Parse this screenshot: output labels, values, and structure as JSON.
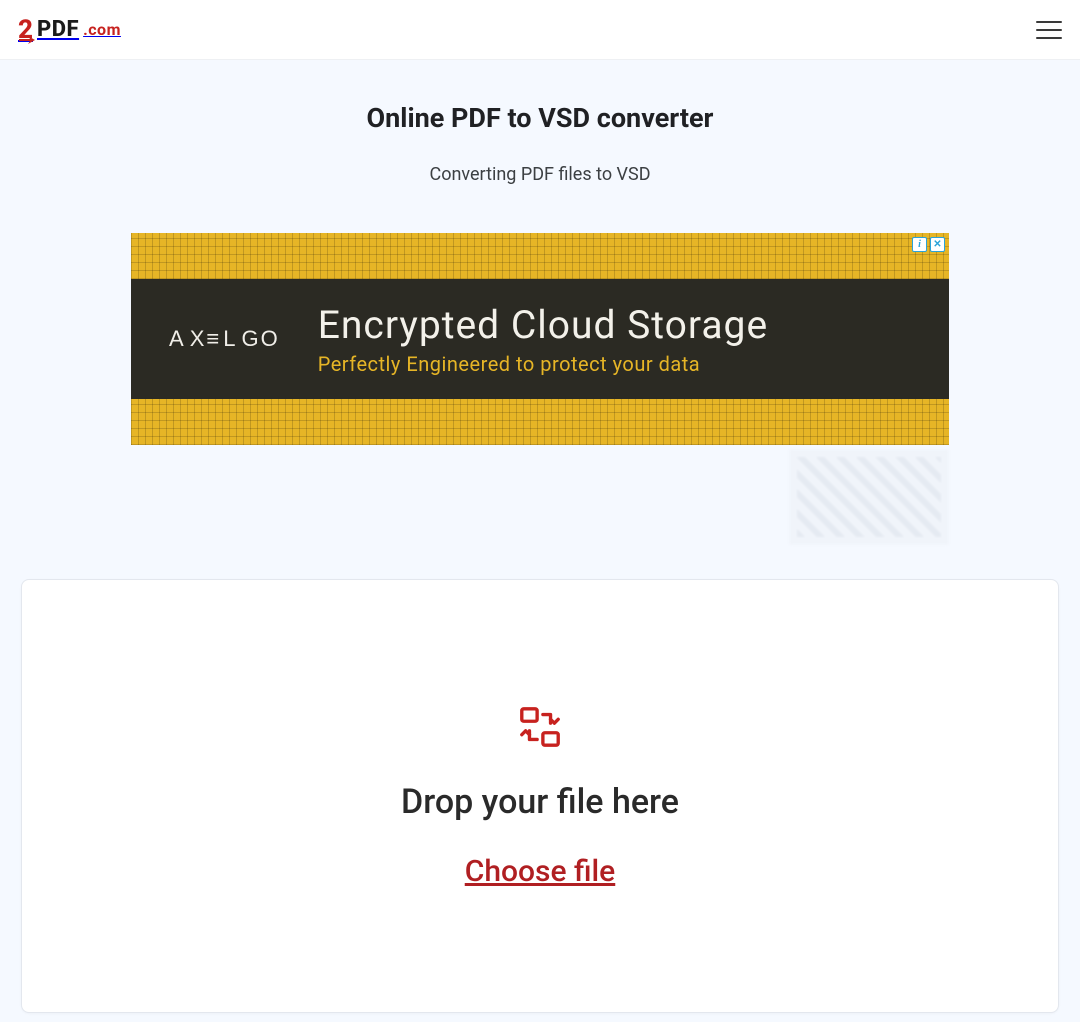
{
  "header": {
    "logo": {
      "two": "2",
      "pdf": "PDF",
      "com": ".com"
    }
  },
  "page": {
    "title": "Online PDF to VSD converter",
    "subtitle": "Converting PDF files to VSD"
  },
  "ad": {
    "brand": "AXELGO",
    "headline": "Encrypted Cloud Storage",
    "subheadline": "Perfectly Engineered to protect your data",
    "info_label": "i",
    "close_label": "✕"
  },
  "dropzone": {
    "title": "Drop your file here",
    "choose_label": "Choose file"
  }
}
